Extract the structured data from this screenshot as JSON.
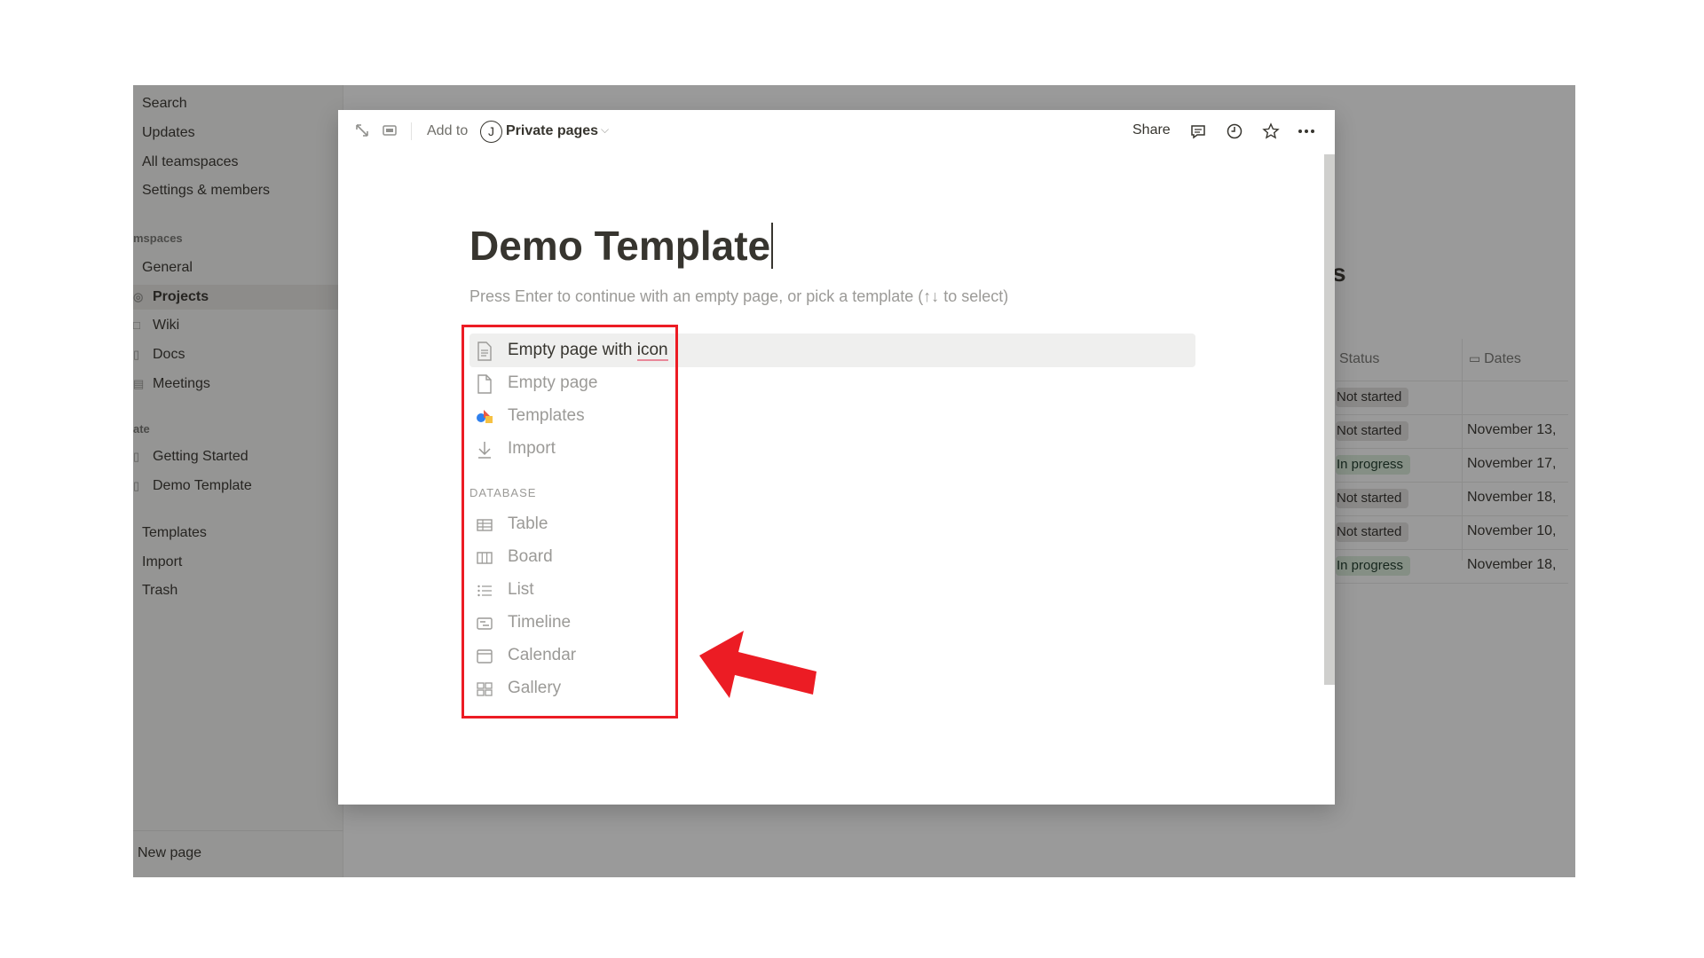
{
  "sidebar": {
    "top_items": [
      "Search",
      "Updates",
      "All teamspaces",
      "Settings & members"
    ],
    "teamspaces_header": "mspaces",
    "teamspaces": [
      "General",
      "Projects",
      "Wiki",
      "Docs",
      "Meetings"
    ],
    "private_header": "ate",
    "private_pages": [
      "Getting Started",
      "Demo Template"
    ],
    "bottom_items": [
      "Templates",
      "Import",
      "Trash"
    ],
    "new_page": "New page"
  },
  "background_table": {
    "title_fragment": "s",
    "columns": [
      "Status",
      "Dates"
    ],
    "rows": [
      {
        "status": "Not started",
        "status_color": "#e3e2e0",
        "date": ""
      },
      {
        "status": "Not started",
        "status_color": "#e3e2e0",
        "date": "November 13,"
      },
      {
        "status": "In progress",
        "status_color": "#dbeddb",
        "date": "November 17,"
      },
      {
        "status": "Not started",
        "status_color": "#e3e2e0",
        "date": "November 18,"
      },
      {
        "status": "Not started",
        "status_color": "#e3e2e0",
        "date": "November 10,"
      },
      {
        "status": "In progress",
        "status_color": "#dbeddb",
        "date": "November 18,"
      }
    ],
    "help_label": "?"
  },
  "modal": {
    "toolbar": {
      "add_to_label": "Add to",
      "workspace_avatar": "J",
      "workspace_name": "Private pages",
      "share_label": "Share"
    },
    "title": "Demo Template",
    "hint": "Press Enter to continue with an empty page, or pick a template (↑↓ to select)",
    "options": [
      {
        "label_main": "Empty page with ",
        "label_underlined": "icon",
        "icon": "page-with-icon-icon"
      },
      {
        "label": "Empty page",
        "icon": "empty-page-icon"
      },
      {
        "label": "Templates",
        "icon": "templates-icon"
      },
      {
        "label": "Import",
        "icon": "import-icon"
      }
    ],
    "database_header": "DATABASE",
    "database_options": [
      {
        "label": "Table",
        "icon": "table-icon"
      },
      {
        "label": "Board",
        "icon": "board-icon"
      },
      {
        "label": "List",
        "icon": "list-icon"
      },
      {
        "label": "Timeline",
        "icon": "timeline-icon"
      },
      {
        "label": "Calendar",
        "icon": "calendar-icon"
      },
      {
        "label": "Gallery",
        "icon": "gallery-icon"
      }
    ]
  },
  "annotation": {
    "box_color": "#ec1c24",
    "arrow_color": "#ec1c24"
  }
}
